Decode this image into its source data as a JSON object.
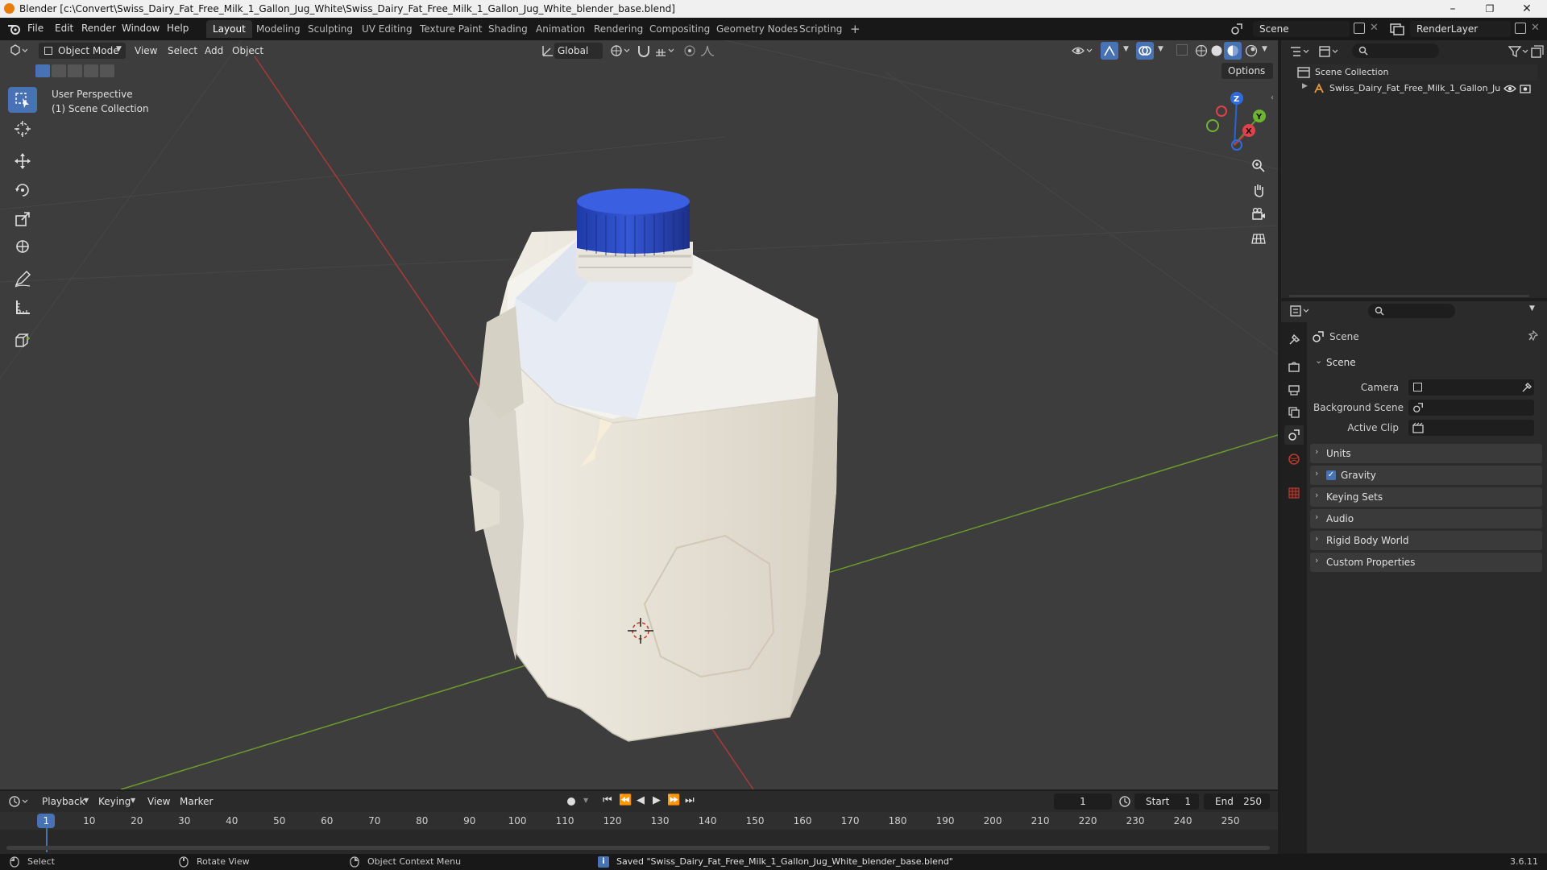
{
  "window": {
    "title": "Blender [c:\\Convert\\Swiss_Dairy_Fat_Free_Milk_1_Gallon_Jug_White\\Swiss_Dairy_Fat_Free_Milk_1_Gallon_Jug_White_blender_base.blend]",
    "minimize": "–",
    "maximize": "❐",
    "close": "✕"
  },
  "menu": [
    "File",
    "Edit",
    "Render",
    "Window",
    "Help"
  ],
  "workspaces": [
    "Layout",
    "Modeling",
    "Sculpting",
    "UV Editing",
    "Texture Paint",
    "Shading",
    "Animation",
    "Rendering",
    "Compositing",
    "Geometry Nodes",
    "Scripting"
  ],
  "workspace_add": "+",
  "active_workspace": "Layout",
  "scene_field": "Scene",
  "viewlayer_field": "RenderLayer",
  "viewport": {
    "mode": "Object Mode",
    "menus": [
      "View",
      "Select",
      "Add",
      "Object"
    ],
    "orientation": "Global",
    "options": "Options",
    "overlay_line1": "User Perspective",
    "overlay_line2": "(1) Scene Collection",
    "gizmo_axes": [
      "Z",
      "Y",
      "X"
    ]
  },
  "outliner": {
    "root": "Scene Collection",
    "item": "Swiss_Dairy_Fat_Free_Milk_1_Gallon_Ju"
  },
  "properties": {
    "header": "Scene",
    "section": "Scene",
    "fields": [
      "Camera",
      "Background Scene",
      "Active Clip"
    ],
    "panels": [
      "Units",
      "Gravity",
      "Keying Sets",
      "Audio",
      "Rigid Body World",
      "Custom Properties"
    ],
    "gravity_checked": true
  },
  "timeline": {
    "menus": [
      "Playback",
      "Keying",
      "View",
      "Marker"
    ],
    "current_frame": "1",
    "start_label": "Start",
    "start": "1",
    "end_label": "End",
    "end": "250",
    "ticks": [
      "1",
      "10",
      "20",
      "30",
      "40",
      "50",
      "60",
      "70",
      "80",
      "90",
      "100",
      "110",
      "120",
      "130",
      "140",
      "150",
      "160",
      "170",
      "180",
      "190",
      "200",
      "210",
      "220",
      "230",
      "240",
      "250"
    ]
  },
  "status": {
    "select": "Select",
    "rotate": "Rotate View",
    "context": "Object Context Menu",
    "message": "Saved \"Swiss_Dairy_Fat_Free_Milk_1_Gallon_Jug_White_blender_base.blend\"",
    "version": "3.6.11"
  },
  "colors": {
    "accent": "#4772b3",
    "cap": "#2e4fc4",
    "jug": "#e8e4da",
    "x_axis": "#a83a3a",
    "y_axis": "#6c9a2c"
  }
}
